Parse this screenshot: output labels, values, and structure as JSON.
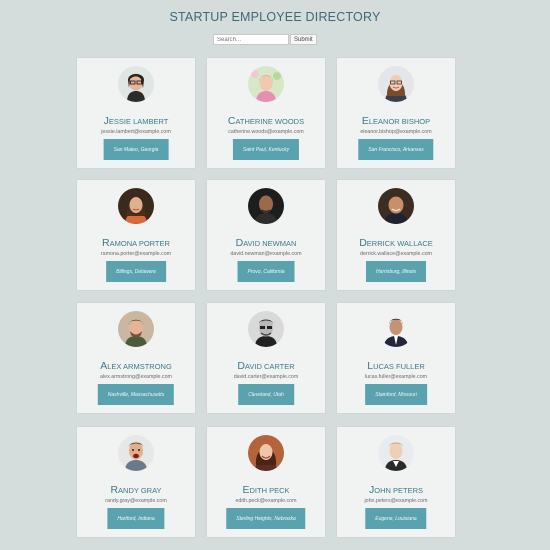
{
  "header": {
    "title": "STARTUP EMPLOYEE DIRECTORY"
  },
  "search": {
    "placeholder": "Search...",
    "submit_label": "Submit"
  },
  "employees": [
    {
      "name": "Jessie Lambert",
      "email": "jessie.lambert@example.com",
      "location": "San Mateo, Georgia"
    },
    {
      "name": "Catherine Woods",
      "email": "catherine.woods@example.com",
      "location": "Saint Paul, Kentucky"
    },
    {
      "name": "Eleanor Bishop",
      "email": "eleanor.bishop@example.com",
      "location": "San Francisco, Arkansas"
    },
    {
      "name": "Ramona Porter",
      "email": "ramona.porter@example.com",
      "location": "Billings, Delaware"
    },
    {
      "name": "David Newman",
      "email": "david.newman@example.com",
      "location": "Provo, California"
    },
    {
      "name": "Derrick Wallace",
      "email": "derrick.wallace@example.com",
      "location": "Harrisburg, Illinois"
    },
    {
      "name": "Alex Armstrong",
      "email": "alex.armstrong@example.com",
      "location": "Nashville, Massachusetts"
    },
    {
      "name": "David Carter",
      "email": "david.carter@example.com",
      "location": "Cleveland, Utah"
    },
    {
      "name": "Lucas Fuller",
      "email": "lucas.fuller@example.com",
      "location": "Stamford, Missouri"
    },
    {
      "name": "Randy Gray",
      "email": "randy.gray@example.com",
      "location": "Hartford, Indiana"
    },
    {
      "name": "Edith Peck",
      "email": "edith.peck@example.com",
      "location": "Sterling Heights, Nebraska"
    },
    {
      "name": "John Peters",
      "email": "john.peters@example.com",
      "location": "Eugene, Louisiana"
    }
  ]
}
